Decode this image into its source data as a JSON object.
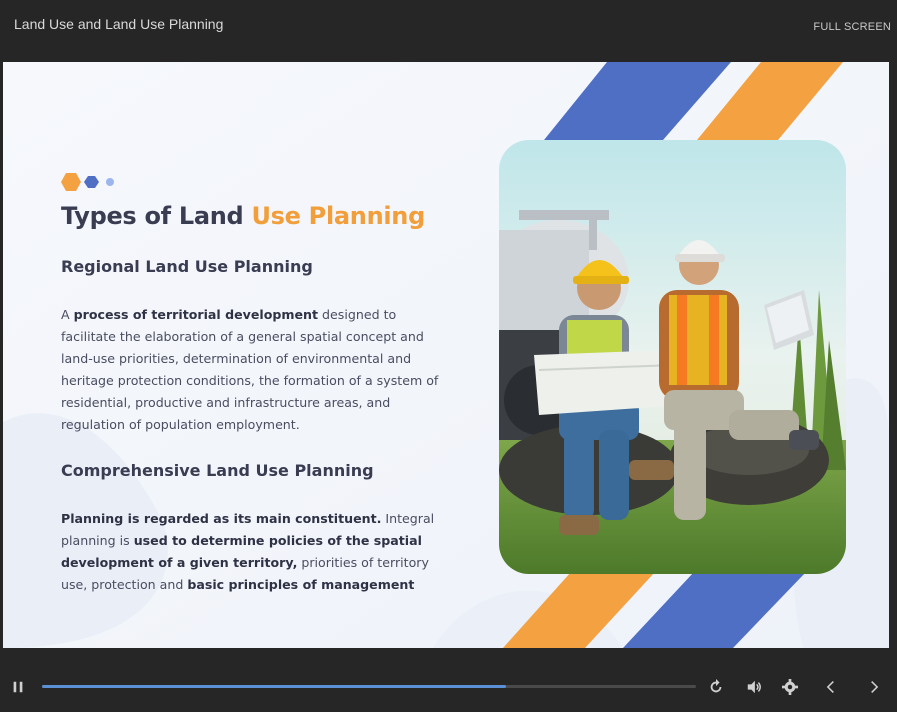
{
  "header": {
    "title": "Land Use and Land Use Planning",
    "fullscreen_label": "FULL SCREEN"
  },
  "slide": {
    "heading_part1": "Types of Land ",
    "heading_part2": "Use Planning",
    "section1": {
      "title": "Regional Land Use Planning",
      "text_a": "A ",
      "text_b_bold": "process of territorial development",
      "text_c": " designed to facilitate the elaboration of a general spatial concept and land-use priorities, determination of environmental and heritage protection conditions, the formation of a system of residential, productive and infrastructure areas, and regulation of population employment."
    },
    "section2": {
      "title": "Comprehensive Land Use Planning",
      "text_a_bold": "Planning is regarded as its main constituent.",
      "text_b": " Integral planning is ",
      "text_c_bold": "used to determine policies of the spatial development of a given territory,",
      "text_d": " priorities of territory use, protection and ",
      "text_e_bold": "basic principles of management"
    },
    "photo_icon": "photo-engineers-icon",
    "colors": {
      "accent_orange": "#f19e3b",
      "accent_blue": "#4f6fc4",
      "heading": "#3a3d52"
    }
  },
  "player": {
    "progress": 0.71,
    "icons": [
      "pause-icon",
      "replay-icon",
      "volume-icon",
      "settings-icon",
      "prev-icon",
      "next-icon"
    ]
  }
}
